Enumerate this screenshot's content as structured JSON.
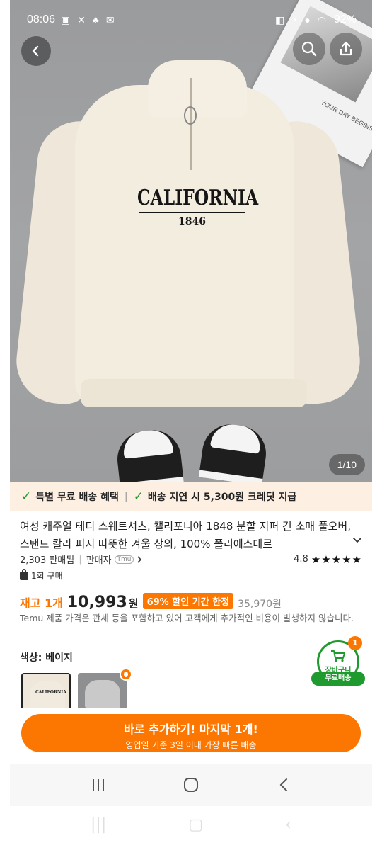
{
  "status_bar": {
    "time": "08:06",
    "battery": "92%"
  },
  "hero": {
    "print_title": "CALIFORNIA",
    "print_subtitle": "1846",
    "image_counter": "1/10",
    "magazine_text": "YOUR DAY BEGINS"
  },
  "benefits": [
    {
      "label": "특별 무료 배송 혜택"
    },
    {
      "label": "배송 지연 시 5,300원 크레딧 지급"
    }
  ],
  "product": {
    "title": "여성 캐주얼 테디 스웨트셔츠, 캘리포니아 1848 분할 지퍼 긴 소매 풀오버, 스탠드 칼라 퍼지 따뜻한 겨울 상의, 100% 폴리에스테르",
    "sold": "2,303 판매됨",
    "seller_label": "판매자",
    "seller_logo": "Tmu",
    "rating": "4.8",
    "rating_stars": "★★★★★",
    "bought": "1회 구매"
  },
  "price": {
    "stock": "재고 1개",
    "current": "10,993",
    "currency": "원",
    "discount": "69% 할인 기간 한정",
    "original": "35,970원"
  },
  "notice": "Temu 제품 가격은 관세 등을 포함하고 있어 고객에게 추가적인 비용이 발생하지 않습니다.",
  "color": {
    "label": "색상: 베이지",
    "swatch_text": "CALIFORNIA"
  },
  "cart": {
    "label": "장바구니",
    "count": "1",
    "free_shipping": "무료배송"
  },
  "cta": {
    "main": "바로 추가하기! 마지막 1개!",
    "sub": "영업일 기준 3일 이내 가장 빠른 배송"
  },
  "colors": {
    "accent": "#fb7701",
    "green": "#1f9a2e",
    "benefit_bg": "#fdf0e3"
  },
  "icons": [
    "back-arrow-icon",
    "search-icon",
    "share-icon",
    "check-icon",
    "chevron-down-icon",
    "chevron-right-icon",
    "bag-icon",
    "cart-icon",
    "recent-apps-icon",
    "home-icon",
    "back-icon"
  ]
}
